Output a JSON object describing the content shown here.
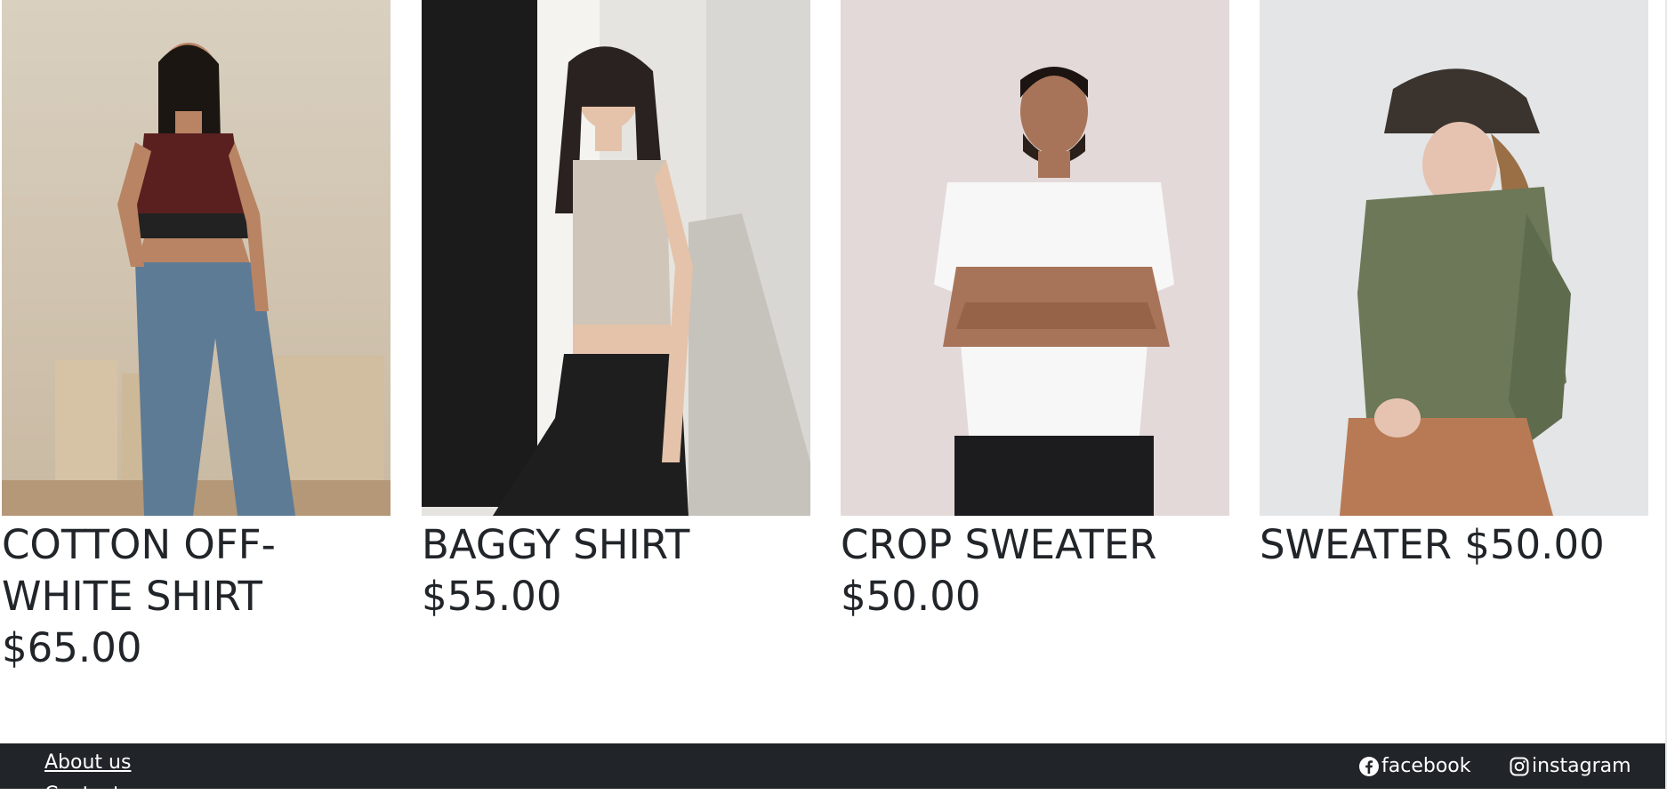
{
  "products": [
    {
      "title": "COTTON OFF-WHITE SHIRT $65.00",
      "photo": "woman-burgundy-crop-top-jeans"
    },
    {
      "title": "BAGGY SHIRT $55.00",
      "photo": "woman-beige-tank-black-jeans"
    },
    {
      "title": "CROP SWEATER $50.00",
      "photo": "man-white-tshirt-arms-crossed"
    },
    {
      "title": "SWEATER $50.00",
      "photo": "woman-green-sweater-cap"
    }
  ],
  "footer": {
    "links": [
      "About us",
      "Contact us"
    ],
    "social": [
      {
        "label": "facebook",
        "icon": "facebook-icon"
      },
      {
        "label": "instagram",
        "icon": "instagram-icon"
      }
    ]
  },
  "colors": {
    "footer_bg": "#212529",
    "text": "#212529",
    "footer_text": "#ffffff"
  }
}
